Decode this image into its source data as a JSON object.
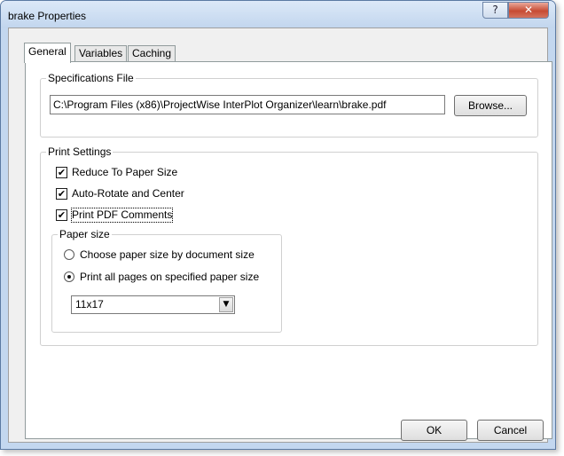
{
  "window": {
    "title": "brake Properties",
    "help_glyph": "?",
    "close_glyph": "✕"
  },
  "tabs": [
    {
      "label": "General",
      "active": true
    },
    {
      "label": "Variables",
      "active": false
    },
    {
      "label": "Caching",
      "active": false
    }
  ],
  "specifications": {
    "legend": "Specifications File",
    "path": "C:\\Program Files (x86)\\ProjectWise InterPlot Organizer\\learn\\brake.pdf",
    "browse_label": "Browse..."
  },
  "print_settings": {
    "legend": "Print Settings",
    "options": [
      {
        "label": "Reduce To Paper Size",
        "checked": true
      },
      {
        "label": "Auto-Rotate and Center",
        "checked": true
      },
      {
        "label": "Print PDF Comments",
        "checked": true
      }
    ],
    "paper_size": {
      "legend": "Paper size",
      "radios": [
        {
          "label": "Choose paper size by document size",
          "selected": false
        },
        {
          "label": "Print all pages on specified paper size",
          "selected": true
        }
      ],
      "selected_size": "11x17"
    }
  },
  "footer": {
    "ok_label": "OK",
    "cancel_label": "Cancel"
  },
  "check_glyph": "✔",
  "dropdown_glyph": "▼"
}
